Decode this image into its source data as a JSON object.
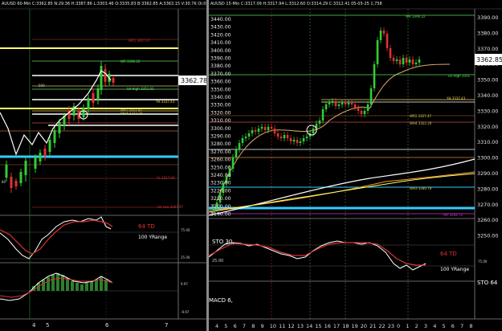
{
  "left": {
    "header": "AUUSD 60-Min  C:3362.85  N:29.36  H:3387.86  L:3303.46  O:3335.83  B:3362.85  A:3363.15  V:30.7K  Oi:0",
    "price_tag": "3362.78",
    "labels": {
      "r1": "WR1 3407.07",
      "m5": "WR 3390.22",
      "lh": "LH High 3351.92",
      "yh": "YH 3337.43",
      "wr1": "WR1 3327.47",
      "wh4": "WH4 3322.29",
      "yl": "YL 3237.00",
      "low": "LH Low 3207.87",
      "n500": "500",
      "n80": "80",
      "td": "64 TD",
      "yrange": "100 YRange",
      "n75": "75.00",
      "n25": "25.00",
      "n997": "9.97",
      "nm997": "-9.97"
    },
    "xaxis": [
      "4",
      "5",
      "6",
      "7"
    ]
  },
  "right": {
    "header": "AUUSD 15-Min  C:3317.09  H:3317.94  L:3312.60  O:3314.29  C:3312.41  05-05-25  1,758",
    "price_tag": "3362.85",
    "yaxis_left": [
      "3440.00",
      "3430.00",
      "3420.00",
      "3410.00",
      "3400.00",
      "3390.00",
      "3380.00",
      "3370.00",
      "3360.00",
      "3350.00",
      "3340.00",
      "3330.00",
      "3320.00",
      "3310.00",
      "3300.00",
      "3290.00",
      "3280.00",
      "3270.00",
      "3260.00",
      "3250.00",
      "3240.00",
      "3230.00",
      "3220.00",
      "3210.00",
      "3200.00",
      "3190.00"
    ],
    "yaxis_right": [
      "3390.00",
      "3380.00",
      "3370.00",
      "3360.00",
      "3350.00",
      "3340.00",
      "3330.00",
      "3320.00",
      "3310.00",
      "3300.00",
      "3290.00",
      "3280.00",
      "3270.00",
      "3260.00",
      "3250.00"
    ],
    "labels": {
      "m5": "WR 3390.22",
      "lh": "LH High 3351",
      "yh": "YH 3337.43",
      "wr1": "WR1 3327.47",
      "wh4": "WH4 3322.29",
      "wh3": "WH3 3280.78",
      "wp": "WP 3264.72",
      "stoA": "STO 30,",
      "td": "64 TD",
      "yrange": "100 YRange",
      "n75": "75.00",
      "n25": "25.00",
      "stoB": "STO 64",
      "macd": "MACD 6,"
    },
    "xaxis": [
      "4",
      "5",
      "6",
      "7",
      "8",
      "9",
      "10",
      "11",
      "12",
      "13",
      "14",
      "15",
      "16",
      "17",
      "18",
      "19",
      "20",
      "21",
      "22",
      "23",
      "0",
      "1",
      "2",
      "3",
      "4",
      "5",
      "6",
      "7",
      "8"
    ]
  }
}
